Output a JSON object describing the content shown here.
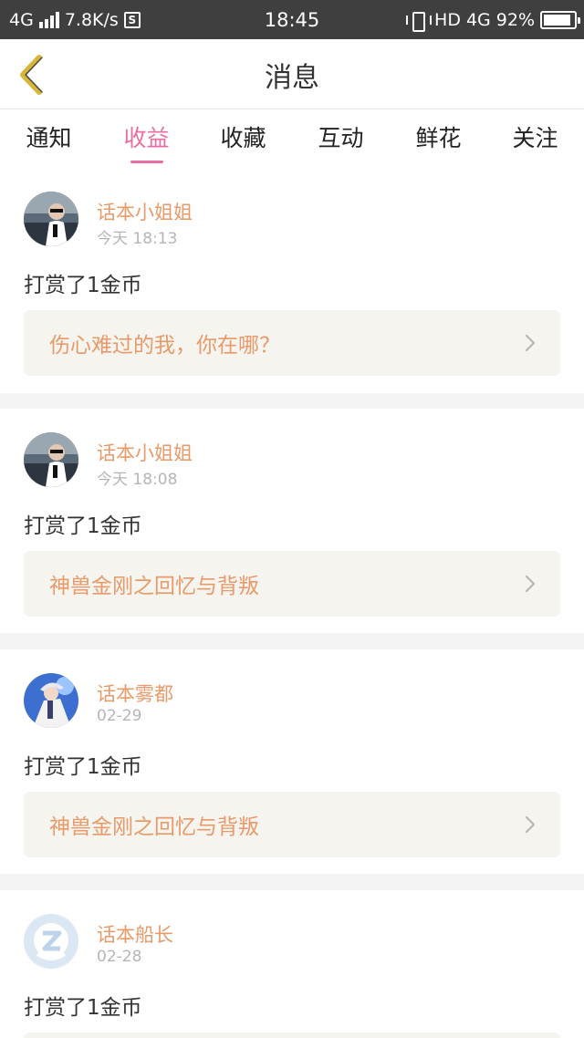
{
  "status_bar": {
    "network": "4G",
    "speed": "7.8K/s",
    "s_icon": "S",
    "time": "18:45",
    "hd": "HD",
    "network_right": "4G",
    "battery": "92%",
    "battery_level": 0.92
  },
  "header": {
    "title": "消息",
    "back_icon": "chevron-left-icon"
  },
  "tabs": [
    {
      "label": "通知",
      "active": false
    },
    {
      "label": "收益",
      "active": true
    },
    {
      "label": "收藏",
      "active": false
    },
    {
      "label": "互动",
      "active": false
    },
    {
      "label": "鲜花",
      "active": false
    },
    {
      "label": "关注",
      "active": false
    }
  ],
  "messages": [
    {
      "user": "话本小姐姐",
      "time": "今天 18:13",
      "action": "打赏了1金币",
      "title": "伤心难过的我，你在哪？"
    },
    {
      "user": "话本小姐姐",
      "time": "今天 18:08",
      "action": "打赏了1金币",
      "title": "神兽金刚之回忆与背叛"
    },
    {
      "user": "话本雾都",
      "time": "02-29",
      "action": "打赏了1金币",
      "title": "神兽金刚之回忆与背叛"
    },
    {
      "user": "话本船长",
      "time": "02-28",
      "action": "打赏了1金币",
      "title": ""
    }
  ],
  "colors": {
    "accent": "#e86ea3",
    "name": "#e89a6a",
    "back_arrow": "#d8b637"
  }
}
